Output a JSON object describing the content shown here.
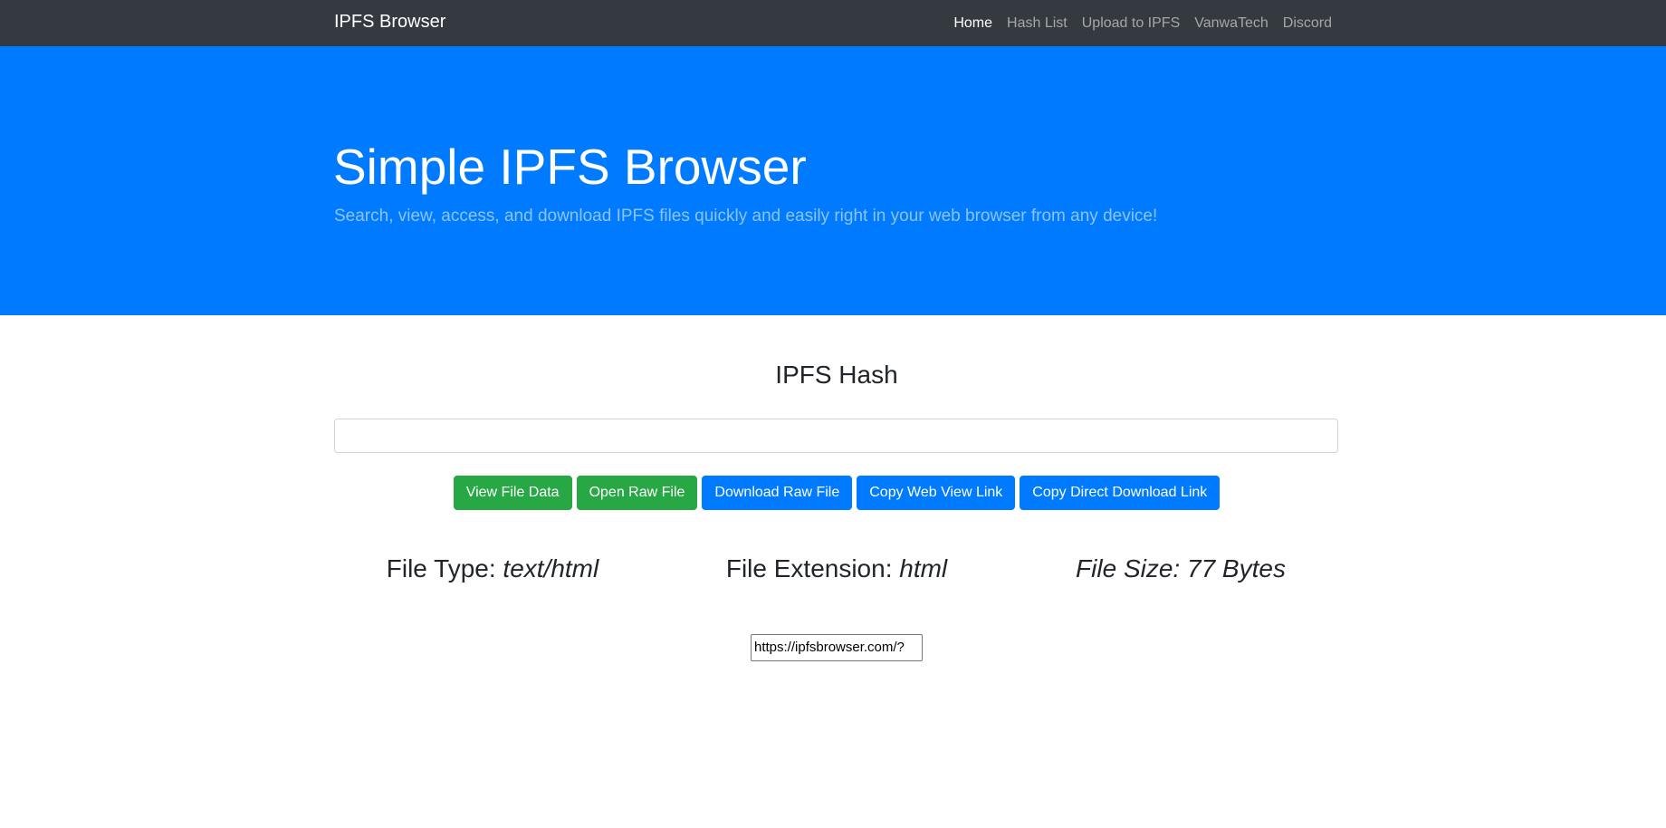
{
  "navbar": {
    "brand": "IPFS Browser",
    "links": [
      "Home",
      "Hash List",
      "Upload to IPFS",
      "VanwaTech",
      "Discord"
    ],
    "active": "Home"
  },
  "hero": {
    "title": "Simple IPFS Browser",
    "subtitle": "Search, view, access, and download IPFS files quickly and easily right in your web browser from any device!",
    "background_color": "#007bff"
  },
  "main": {
    "section_title": "IPFS Hash",
    "hash_input_value": "",
    "buttons": {
      "view_file_data": "View File Data",
      "open_raw_file": "Open Raw File",
      "download_raw_file": "Download Raw File",
      "copy_web_view_link": "Copy Web View Link",
      "copy_direct_download_link": "Copy Direct Download Link"
    },
    "file_info": {
      "type_label": "File Type: ",
      "type_value": "text/html",
      "extension_label": "File Extension: ",
      "extension_value": "html",
      "size_label": "File Size: ",
      "size_value": "77 Bytes"
    },
    "link_box_value": "https://ipfsbrowser.com/?"
  }
}
